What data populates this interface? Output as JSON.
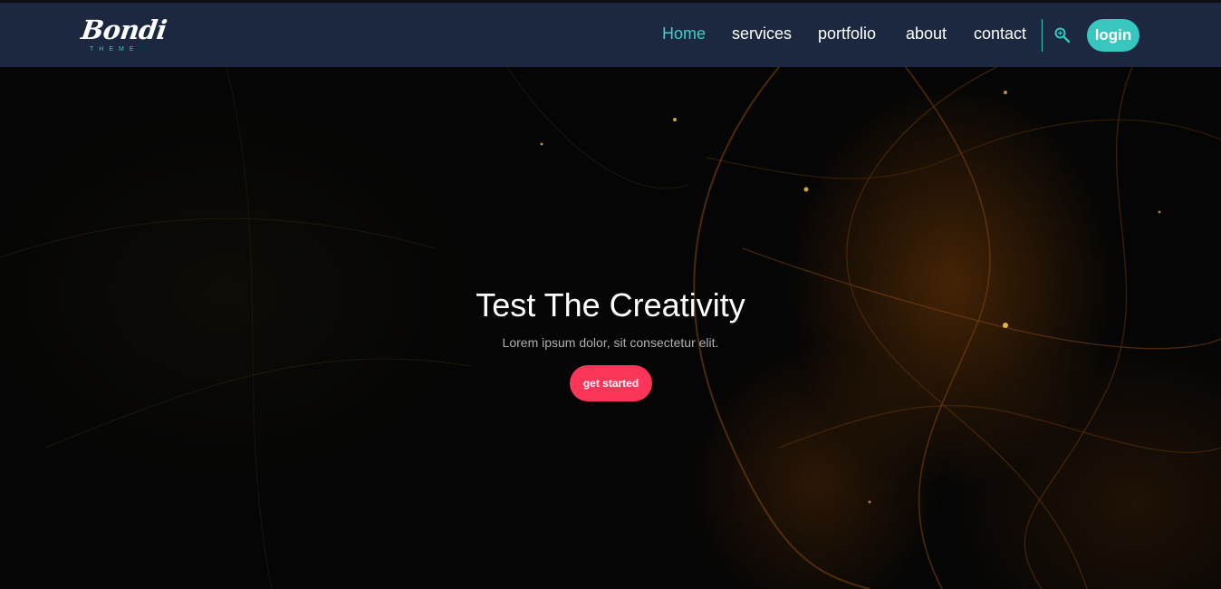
{
  "logo": {
    "main": "Bondi",
    "sub": "THEME"
  },
  "nav": {
    "items": [
      {
        "label": "Home",
        "active": true
      },
      {
        "label": "services",
        "active": false
      },
      {
        "label": "portfolio",
        "active": false
      },
      {
        "label": "about",
        "active": false
      },
      {
        "label": "contact",
        "active": false
      }
    ],
    "search_icon": "search-icon",
    "login_label": "login"
  },
  "hero": {
    "title": "Test The Creativity",
    "subtitle": "Lorem ipsum dolor, sit consectetur elit.",
    "cta_label": "get started"
  },
  "colors": {
    "navbar_bg": "#1b2840",
    "accent": "#37c7bf",
    "cta": "#fc3559",
    "hero_bg": "#050505"
  }
}
